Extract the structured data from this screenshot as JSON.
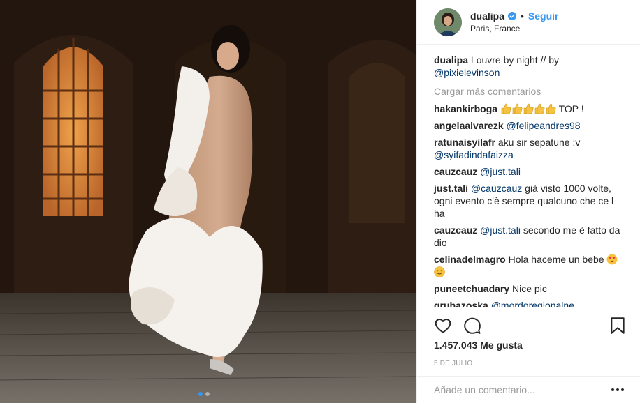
{
  "post": {
    "photo_alt": "Louvre by night photo",
    "carousel": {
      "count": 2,
      "active_index": 0
    }
  },
  "header": {
    "username": "dualipa",
    "verified": true,
    "separator": "•",
    "follow_label": "Seguir",
    "location": "Paris, France"
  },
  "caption": {
    "author": "dualipa",
    "text_line": "Louvre by night // by",
    "mention": "@pixielevinson"
  },
  "load_more_label": "Cargar más comentarios",
  "comments": [
    {
      "author": "hakankirboga",
      "text": "TOP !",
      "emoji": [
        "thumbs-up",
        "thumbs-up",
        "thumbs-up",
        "thumbs-up",
        "thumbs-up"
      ]
    },
    {
      "author": "angelaalvarezk",
      "mention": "@felipeandres98",
      "text": ""
    },
    {
      "author": "ratunaisyilafr",
      "text": "aku sir sepatune :v",
      "mention": "@syifadindafaizza"
    },
    {
      "author": "cauzcauz",
      "mention": "@just.tali",
      "text": ""
    },
    {
      "author": "just.tali",
      "mention": "@cauzcauz",
      "text": "già visto 1000 volte, ogni evento c'è sempre qualcuno che ce l ha"
    },
    {
      "author": "cauzcauz",
      "mention": "@just.tali",
      "text": "secondo me è fatto da dio"
    },
    {
      "author": "celinadelmagro",
      "text": "Hola haceme un bebe",
      "emoji": [
        "heart-eyes",
        "smiley"
      ]
    },
    {
      "author": "puneetchuadary",
      "text": "Nice pic"
    },
    {
      "author": "grubazoska",
      "mention": "@mordoregionalne",
      "text": ""
    }
  ],
  "actions": {
    "like_icon": "heart-icon",
    "comment_icon": "speech-bubble-icon",
    "save_icon": "bookmark-icon"
  },
  "likes": "1.457.043 Me gusta",
  "date": "5 DE JULIO",
  "add_comment": {
    "placeholder": "Añade un comentario..."
  },
  "colors": {
    "link": "#3897f0",
    "mention": "#003569",
    "muted": "#999999",
    "border": "#efefef"
  }
}
